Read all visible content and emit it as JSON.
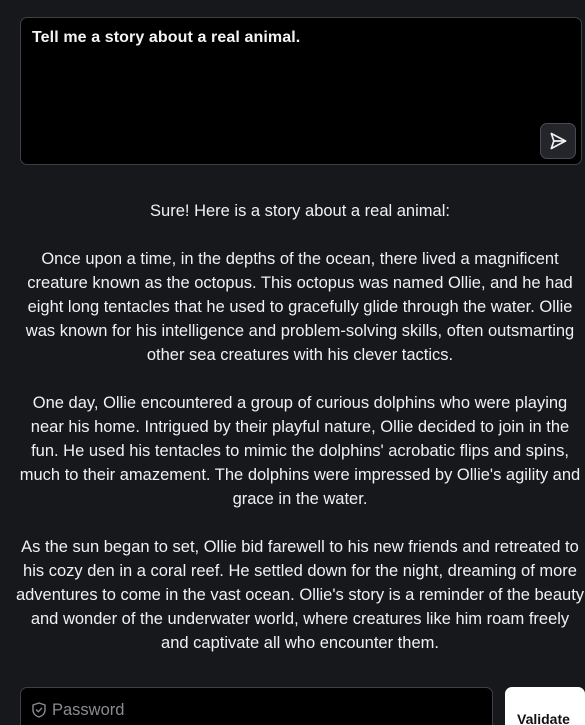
{
  "prompt": {
    "text": "Tell me a story about a real animal."
  },
  "send": {
    "icon": "send-icon"
  },
  "response": {
    "paragraphs": [
      "Sure! Here is a story about a real animal:",
      "Once upon a time, in the depths of the ocean, there lived a magnificent creature known as the octopus. This octopus was named Ollie, and he had eight long tentacles that he used to gracefully glide through the water. Ollie was known for his intelligence and problem-solving skills, often outsmarting other sea creatures with his clever tactics.",
      "One day, Ollie encountered a group of curious dolphins who were playing near his home. Intrigued by their playful nature, Ollie decided to join in the fun. He used his tentacles to mimic the dolphins' acrobatic flips and spins, much to their amazement. The dolphins were impressed by Ollie's agility and grace in the water.",
      "As the sun began to set, Ollie bid farewell to his new friends and retreated to his cozy den in a coral reef. He settled down for the night, dreaming of more adventures to come in the vast ocean. Ollie's story is a reminder of the beauty and wonder of the underwater world, where creatures like him roam freely and captivate all who encounter them."
    ]
  },
  "password": {
    "placeholder": "Password",
    "value": "",
    "icon": "shield-icon"
  },
  "validate": {
    "label": "Validate"
  },
  "colors": {
    "background": "#17181b",
    "input_background": "#000000",
    "border": "#3f4046",
    "button_background": "#ffffff"
  }
}
